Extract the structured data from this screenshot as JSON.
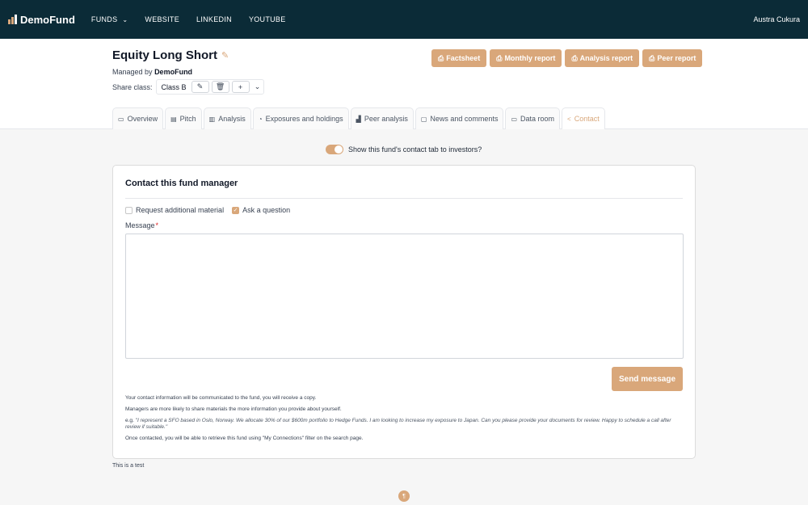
{
  "topbar": {
    "logo_text": "DemoFund",
    "nav": [
      {
        "label": "FUNDS",
        "has_dropdown": true
      },
      {
        "label": "WEBSITE"
      },
      {
        "label": "LINKEDIN"
      },
      {
        "label": "YOUTUBE"
      }
    ],
    "user_name": "Austra Cukura"
  },
  "fund": {
    "title": "Equity Long Short",
    "managed_prefix": "Managed by",
    "manager": "DemoFund",
    "share_class_label": "Share class:",
    "share_class_value": "Class B"
  },
  "reports": [
    {
      "label": "Factsheet",
      "icon": "printer-icon"
    },
    {
      "label": "Monthly report",
      "icon": "printer-icon"
    },
    {
      "label": "Analysis report",
      "icon": "printer-icon"
    },
    {
      "label": "Peer report",
      "icon": "printer-icon"
    }
  ],
  "tabs": [
    {
      "label": "Overview",
      "icon": "overview-icon",
      "glyph": "▭"
    },
    {
      "label": "Pitch",
      "icon": "book-icon",
      "glyph": "▤"
    },
    {
      "label": "Analysis",
      "icon": "bar-chart-icon",
      "glyph": "▥"
    },
    {
      "label": "Exposures and holdings",
      "icon": "pie-chart-icon",
      "glyph": "◔"
    },
    {
      "label": "Peer analysis",
      "icon": "peer-chart-icon",
      "glyph": "▟"
    },
    {
      "label": "News and comments",
      "icon": "comment-icon",
      "glyph": "▢"
    },
    {
      "label": "Data room",
      "icon": "folder-icon",
      "glyph": "▭"
    },
    {
      "label": "Contact",
      "icon": "share-icon",
      "glyph": "<",
      "active": true
    }
  ],
  "contact": {
    "toggle_label": "Show this fund's contact tab to investors?",
    "toggle_on": true,
    "card_title": "Contact this fund manager",
    "options": [
      {
        "label": "Request additional material",
        "checked": false
      },
      {
        "label": "Ask a question",
        "checked": true
      }
    ],
    "message_label": "Message",
    "message_required": "*",
    "message_value": "",
    "send_label": "Send message",
    "note1": "Your contact information will be communicated to the fund, you will receive a copy.",
    "note2": "Managers are more likely to share materials the more information you provide about yourself.",
    "note3_prefix": "e.g.",
    "note3_example": "\"I represent a SFO based in Oslo, Norway. We allocate 30% of our $600m portfolio to Hedge Funds. I am looking to increase my exposure to Japan. Can you please provide your documents for review. Happy to schedule a call after review if suitable.\"",
    "note4": "Once contacted, you will be able to retrieve this fund using \"My Connections\" filter on the search page."
  },
  "footer_text": "This is a test",
  "colors": {
    "accent": "#d9a77a",
    "topbar": "#0b2b37"
  }
}
